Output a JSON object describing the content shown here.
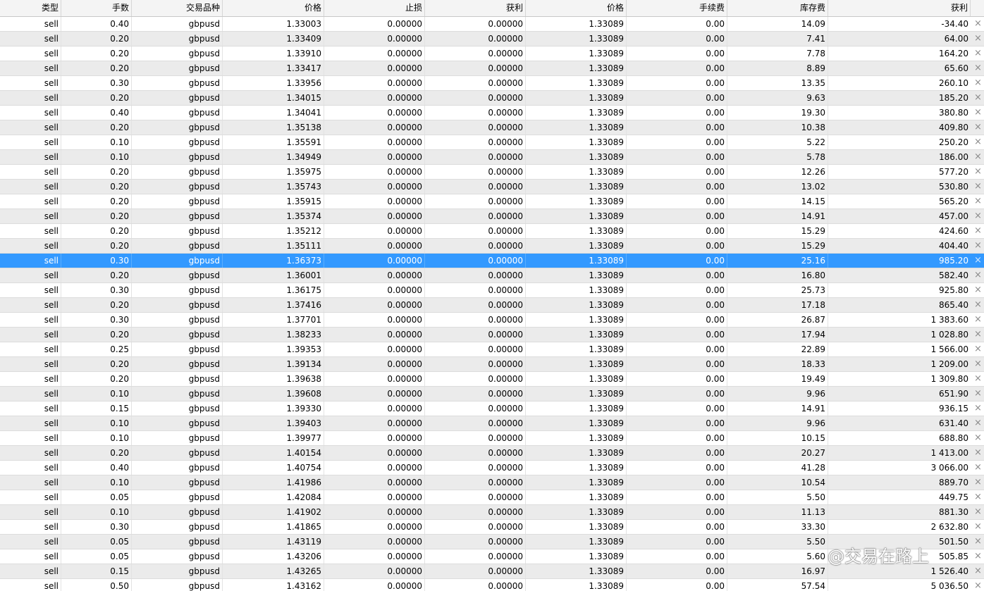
{
  "columns": [
    "类型",
    "手数",
    "交易品种",
    "价格",
    "止损",
    "获利",
    "价格",
    "手续费",
    "库存费",
    "获利"
  ],
  "close_glyph": "×",
  "watermark": "@交易在路上",
  "selected_row_index": 16,
  "rows": [
    {
      "type": "sell",
      "lots": "0.40",
      "symbol": "gbpusd",
      "open_price": "1.33003",
      "sl": "0.00000",
      "tp": "0.00000",
      "price": "1.33089",
      "commission": "0.00",
      "swap": "14.09",
      "profit": "-34.40"
    },
    {
      "type": "sell",
      "lots": "0.20",
      "symbol": "gbpusd",
      "open_price": "1.33409",
      "sl": "0.00000",
      "tp": "0.00000",
      "price": "1.33089",
      "commission": "0.00",
      "swap": "7.41",
      "profit": "64.00"
    },
    {
      "type": "sell",
      "lots": "0.20",
      "symbol": "gbpusd",
      "open_price": "1.33910",
      "sl": "0.00000",
      "tp": "0.00000",
      "price": "1.33089",
      "commission": "0.00",
      "swap": "7.78",
      "profit": "164.20"
    },
    {
      "type": "sell",
      "lots": "0.20",
      "symbol": "gbpusd",
      "open_price": "1.33417",
      "sl": "0.00000",
      "tp": "0.00000",
      "price": "1.33089",
      "commission": "0.00",
      "swap": "8.89",
      "profit": "65.60"
    },
    {
      "type": "sell",
      "lots": "0.30",
      "symbol": "gbpusd",
      "open_price": "1.33956",
      "sl": "0.00000",
      "tp": "0.00000",
      "price": "1.33089",
      "commission": "0.00",
      "swap": "13.35",
      "profit": "260.10"
    },
    {
      "type": "sell",
      "lots": "0.20",
      "symbol": "gbpusd",
      "open_price": "1.34015",
      "sl": "0.00000",
      "tp": "0.00000",
      "price": "1.33089",
      "commission": "0.00",
      "swap": "9.63",
      "profit": "185.20"
    },
    {
      "type": "sell",
      "lots": "0.40",
      "symbol": "gbpusd",
      "open_price": "1.34041",
      "sl": "0.00000",
      "tp": "0.00000",
      "price": "1.33089",
      "commission": "0.00",
      "swap": "19.30",
      "profit": "380.80"
    },
    {
      "type": "sell",
      "lots": "0.20",
      "symbol": "gbpusd",
      "open_price": "1.35138",
      "sl": "0.00000",
      "tp": "0.00000",
      "price": "1.33089",
      "commission": "0.00",
      "swap": "10.38",
      "profit": "409.80"
    },
    {
      "type": "sell",
      "lots": "0.10",
      "symbol": "gbpusd",
      "open_price": "1.35591",
      "sl": "0.00000",
      "tp": "0.00000",
      "price": "1.33089",
      "commission": "0.00",
      "swap": "5.22",
      "profit": "250.20"
    },
    {
      "type": "sell",
      "lots": "0.10",
      "symbol": "gbpusd",
      "open_price": "1.34949",
      "sl": "0.00000",
      "tp": "0.00000",
      "price": "1.33089",
      "commission": "0.00",
      "swap": "5.78",
      "profit": "186.00"
    },
    {
      "type": "sell",
      "lots": "0.20",
      "symbol": "gbpusd",
      "open_price": "1.35975",
      "sl": "0.00000",
      "tp": "0.00000",
      "price": "1.33089",
      "commission": "0.00",
      "swap": "12.26",
      "profit": "577.20"
    },
    {
      "type": "sell",
      "lots": "0.20",
      "symbol": "gbpusd",
      "open_price": "1.35743",
      "sl": "0.00000",
      "tp": "0.00000",
      "price": "1.33089",
      "commission": "0.00",
      "swap": "13.02",
      "profit": "530.80"
    },
    {
      "type": "sell",
      "lots": "0.20",
      "symbol": "gbpusd",
      "open_price": "1.35915",
      "sl": "0.00000",
      "tp": "0.00000",
      "price": "1.33089",
      "commission": "0.00",
      "swap": "14.15",
      "profit": "565.20"
    },
    {
      "type": "sell",
      "lots": "0.20",
      "symbol": "gbpusd",
      "open_price": "1.35374",
      "sl": "0.00000",
      "tp": "0.00000",
      "price": "1.33089",
      "commission": "0.00",
      "swap": "14.91",
      "profit": "457.00"
    },
    {
      "type": "sell",
      "lots": "0.20",
      "symbol": "gbpusd",
      "open_price": "1.35212",
      "sl": "0.00000",
      "tp": "0.00000",
      "price": "1.33089",
      "commission": "0.00",
      "swap": "15.29",
      "profit": "424.60"
    },
    {
      "type": "sell",
      "lots": "0.20",
      "symbol": "gbpusd",
      "open_price": "1.35111",
      "sl": "0.00000",
      "tp": "0.00000",
      "price": "1.33089",
      "commission": "0.00",
      "swap": "15.29",
      "profit": "404.40"
    },
    {
      "type": "sell",
      "lots": "0.30",
      "symbol": "gbpusd",
      "open_price": "1.36373",
      "sl": "0.00000",
      "tp": "0.00000",
      "price": "1.33089",
      "commission": "0.00",
      "swap": "25.16",
      "profit": "985.20"
    },
    {
      "type": "sell",
      "lots": "0.20",
      "symbol": "gbpusd",
      "open_price": "1.36001",
      "sl": "0.00000",
      "tp": "0.00000",
      "price": "1.33089",
      "commission": "0.00",
      "swap": "16.80",
      "profit": "582.40"
    },
    {
      "type": "sell",
      "lots": "0.30",
      "symbol": "gbpusd",
      "open_price": "1.36175",
      "sl": "0.00000",
      "tp": "0.00000",
      "price": "1.33089",
      "commission": "0.00",
      "swap": "25.73",
      "profit": "925.80"
    },
    {
      "type": "sell",
      "lots": "0.20",
      "symbol": "gbpusd",
      "open_price": "1.37416",
      "sl": "0.00000",
      "tp": "0.00000",
      "price": "1.33089",
      "commission": "0.00",
      "swap": "17.18",
      "profit": "865.40"
    },
    {
      "type": "sell",
      "lots": "0.30",
      "symbol": "gbpusd",
      "open_price": "1.37701",
      "sl": "0.00000",
      "tp": "0.00000",
      "price": "1.33089",
      "commission": "0.00",
      "swap": "26.87",
      "profit": "1 383.60"
    },
    {
      "type": "sell",
      "lots": "0.20",
      "symbol": "gbpusd",
      "open_price": "1.38233",
      "sl": "0.00000",
      "tp": "0.00000",
      "price": "1.33089",
      "commission": "0.00",
      "swap": "17.94",
      "profit": "1 028.80"
    },
    {
      "type": "sell",
      "lots": "0.25",
      "symbol": "gbpusd",
      "open_price": "1.39353",
      "sl": "0.00000",
      "tp": "0.00000",
      "price": "1.33089",
      "commission": "0.00",
      "swap": "22.89",
      "profit": "1 566.00"
    },
    {
      "type": "sell",
      "lots": "0.20",
      "symbol": "gbpusd",
      "open_price": "1.39134",
      "sl": "0.00000",
      "tp": "0.00000",
      "price": "1.33089",
      "commission": "0.00",
      "swap": "18.33",
      "profit": "1 209.00"
    },
    {
      "type": "sell",
      "lots": "0.20",
      "symbol": "gbpusd",
      "open_price": "1.39638",
      "sl": "0.00000",
      "tp": "0.00000",
      "price": "1.33089",
      "commission": "0.00",
      "swap": "19.49",
      "profit": "1 309.80"
    },
    {
      "type": "sell",
      "lots": "0.10",
      "symbol": "gbpusd",
      "open_price": "1.39608",
      "sl": "0.00000",
      "tp": "0.00000",
      "price": "1.33089",
      "commission": "0.00",
      "swap": "9.96",
      "profit": "651.90"
    },
    {
      "type": "sell",
      "lots": "0.15",
      "symbol": "gbpusd",
      "open_price": "1.39330",
      "sl": "0.00000",
      "tp": "0.00000",
      "price": "1.33089",
      "commission": "0.00",
      "swap": "14.91",
      "profit": "936.15"
    },
    {
      "type": "sell",
      "lots": "0.10",
      "symbol": "gbpusd",
      "open_price": "1.39403",
      "sl": "0.00000",
      "tp": "0.00000",
      "price": "1.33089",
      "commission": "0.00",
      "swap": "9.96",
      "profit": "631.40"
    },
    {
      "type": "sell",
      "lots": "0.10",
      "symbol": "gbpusd",
      "open_price": "1.39977",
      "sl": "0.00000",
      "tp": "0.00000",
      "price": "1.33089",
      "commission": "0.00",
      "swap": "10.15",
      "profit": "688.80"
    },
    {
      "type": "sell",
      "lots": "0.20",
      "symbol": "gbpusd",
      "open_price": "1.40154",
      "sl": "0.00000",
      "tp": "0.00000",
      "price": "1.33089",
      "commission": "0.00",
      "swap": "20.27",
      "profit": "1 413.00"
    },
    {
      "type": "sell",
      "lots": "0.40",
      "symbol": "gbpusd",
      "open_price": "1.40754",
      "sl": "0.00000",
      "tp": "0.00000",
      "price": "1.33089",
      "commission": "0.00",
      "swap": "41.28",
      "profit": "3 066.00"
    },
    {
      "type": "sell",
      "lots": "0.10",
      "symbol": "gbpusd",
      "open_price": "1.41986",
      "sl": "0.00000",
      "tp": "0.00000",
      "price": "1.33089",
      "commission": "0.00",
      "swap": "10.54",
      "profit": "889.70"
    },
    {
      "type": "sell",
      "lots": "0.05",
      "symbol": "gbpusd",
      "open_price": "1.42084",
      "sl": "0.00000",
      "tp": "0.00000",
      "price": "1.33089",
      "commission": "0.00",
      "swap": "5.50",
      "profit": "449.75"
    },
    {
      "type": "sell",
      "lots": "0.10",
      "symbol": "gbpusd",
      "open_price": "1.41902",
      "sl": "0.00000",
      "tp": "0.00000",
      "price": "1.33089",
      "commission": "0.00",
      "swap": "11.13",
      "profit": "881.30"
    },
    {
      "type": "sell",
      "lots": "0.30",
      "symbol": "gbpusd",
      "open_price": "1.41865",
      "sl": "0.00000",
      "tp": "0.00000",
      "price": "1.33089",
      "commission": "0.00",
      "swap": "33.30",
      "profit": "2 632.80"
    },
    {
      "type": "sell",
      "lots": "0.05",
      "symbol": "gbpusd",
      "open_price": "1.43119",
      "sl": "0.00000",
      "tp": "0.00000",
      "price": "1.33089",
      "commission": "0.00",
      "swap": "5.50",
      "profit": "501.50"
    },
    {
      "type": "sell",
      "lots": "0.05",
      "symbol": "gbpusd",
      "open_price": "1.43206",
      "sl": "0.00000",
      "tp": "0.00000",
      "price": "1.33089",
      "commission": "0.00",
      "swap": "5.60",
      "profit": "505.85"
    },
    {
      "type": "sell",
      "lots": "0.15",
      "symbol": "gbpusd",
      "open_price": "1.43265",
      "sl": "0.00000",
      "tp": "0.00000",
      "price": "1.33089",
      "commission": "0.00",
      "swap": "16.97",
      "profit": "1 526.40"
    },
    {
      "type": "sell",
      "lots": "0.50",
      "symbol": "gbpusd",
      "open_price": "1.43162",
      "sl": "0.00000",
      "tp": "0.00000",
      "price": "1.33089",
      "commission": "0.00",
      "swap": "57.54",
      "profit": "5 036.50"
    }
  ]
}
